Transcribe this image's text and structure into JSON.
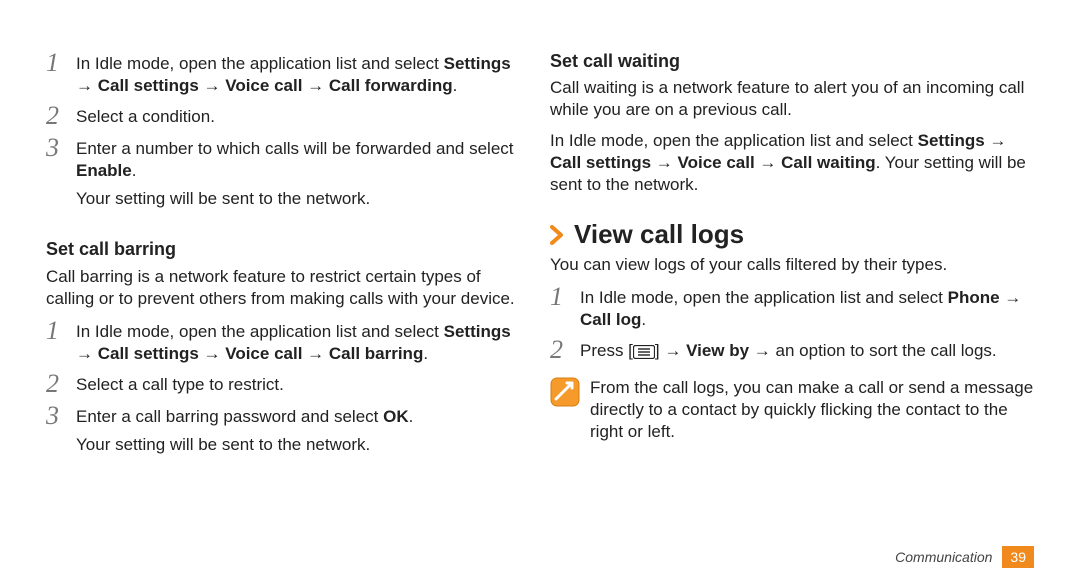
{
  "left": {
    "step1": {
      "pre": "In Idle mode, open the application list and select ",
      "boldpath": "Settings → Call settings → Voice call → Call forwarding",
      "post": "."
    },
    "step2": "Select a condition.",
    "step3": {
      "pre": "Enter a number to which calls will be forwarded and select ",
      "bold": "Enable",
      "post": "."
    },
    "step3_after": "Your setting will be sent to the network.",
    "barring_heading": "Set call barring",
    "barring_intro": "Call barring is a network feature to restrict certain types of calling or to prevent others from making calls with your device.",
    "b_step1": {
      "pre": "In Idle mode, open the application list and select ",
      "boldpath": "Settings → Call settings → Voice call → Call barring",
      "post": "."
    },
    "b_step2": "Select a call type to restrict.",
    "b_step3": {
      "pre": "Enter a call barring password and select ",
      "bold": "OK",
      "post": "."
    },
    "b_step3_after": "Your setting will be sent to the network."
  },
  "right": {
    "waiting_heading": "Set call waiting",
    "waiting_intro": "Call waiting is a network feature to alert you of an incoming call while you are on a previous call.",
    "waiting_body": {
      "pre": "In Idle mode, open the application list and select ",
      "bold1": "Settings → Call settings → Voice call → Call waiting",
      "mid": ". Your setting will be sent to the network."
    },
    "logs_heading": "View call logs",
    "logs_intro": "You can view logs of your calls filtered by their types.",
    "l_step1": {
      "pre": "In Idle mode, open the application list and select ",
      "bold": "Phone → Call log",
      "post": "."
    },
    "l_step2": {
      "pre": "Press [",
      "mid1": "] → ",
      "bold": "View by",
      "mid2": " → an option to sort the call logs."
    },
    "note": "From the call logs, you can make a call or send a message directly to a contact by quickly flicking the contact to the right or left."
  },
  "footer": {
    "section": "Communication",
    "page": "39"
  },
  "glyphs": {
    "num1": "1",
    "num2": "2",
    "num3": "3"
  }
}
